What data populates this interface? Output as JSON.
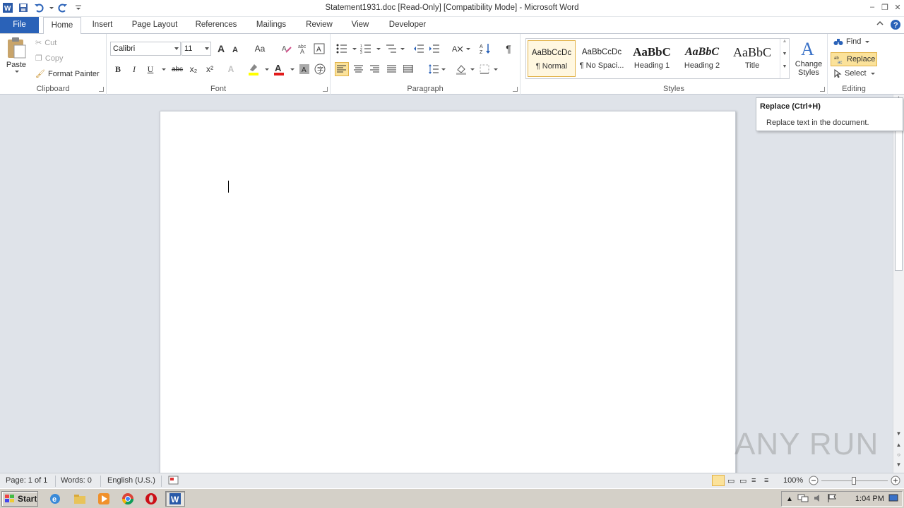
{
  "window": {
    "title": "Statement1931.doc [Read-Only] [Compatibility Mode] - Microsoft Word"
  },
  "tabs": {
    "file": "File",
    "items": [
      "Home",
      "Insert",
      "Page Layout",
      "References",
      "Mailings",
      "Review",
      "View",
      "Developer"
    ],
    "active": "Home"
  },
  "clipboard": {
    "label": "Clipboard",
    "paste": "Paste",
    "cut": "Cut",
    "copy": "Copy",
    "format_painter": "Format Painter"
  },
  "font": {
    "label": "Font",
    "family": "Calibri",
    "size": "11",
    "bold": "B",
    "italic": "I",
    "underline": "U",
    "strike": "abc",
    "subscript": "x₂",
    "superscript": "x²",
    "grow": "A",
    "shrink": "A",
    "change_case": "Aa"
  },
  "paragraph": {
    "label": "Paragraph",
    "pilcrow": "¶"
  },
  "styles": {
    "label": "Styles",
    "items": [
      {
        "preview": "AaBbCcDc",
        "name": "¶ Normal"
      },
      {
        "preview": "AaBbCcDc",
        "name": "¶ No Spaci..."
      },
      {
        "preview": "AaBbC",
        "name": "Heading 1"
      },
      {
        "preview": "AaBbC",
        "name": "Heading 2"
      },
      {
        "preview": "AaBbC",
        "name": "Title"
      }
    ],
    "change_styles": "Change Styles"
  },
  "editing": {
    "label": "Editing",
    "find": "Find",
    "replace": "Replace",
    "select": "Select"
  },
  "tooltip": {
    "title": "Replace (Ctrl+H)",
    "body": "Replace text in the document."
  },
  "statusbar": {
    "page": "Page: 1 of 1",
    "words": "Words: 0",
    "language": "English (U.S.)",
    "zoom": "100%"
  },
  "taskbar": {
    "start": "Start",
    "clock": "1:04 PM"
  },
  "watermark": "ANY RUN",
  "colors": {
    "file_tab": "#2a62b8",
    "highlight": "#fbe29a",
    "font_color": "#e21b1b",
    "highlight_color": "#ffff00"
  }
}
